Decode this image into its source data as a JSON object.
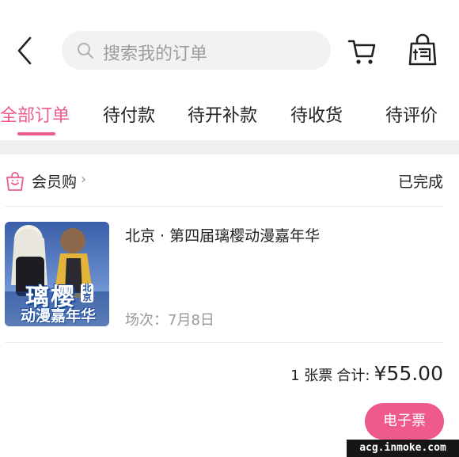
{
  "header": {
    "search_placeholder": "搜索我的订单",
    "icons": {
      "back": "chevron-left-icon",
      "search": "search-icon",
      "cart": "cart-icon",
      "bag": "shopping-bag-icon"
    }
  },
  "tabs": [
    {
      "label": "全部订单",
      "active": true
    },
    {
      "label": "待付款",
      "active": false
    },
    {
      "label": "待开补款",
      "active": false
    },
    {
      "label": "待收货",
      "active": false
    },
    {
      "label": "待评价",
      "active": false
    }
  ],
  "order": {
    "shop_name": "会员购",
    "status": "已完成",
    "event_title": "北京 · 第四届璃樱动漫嘉年华",
    "session": "场次：7月8日",
    "poster": {
      "main_text": "璃樱",
      "badge_text": "北京",
      "sub_text": "动漫嘉年华"
    },
    "quantity": "1 张票",
    "total_label": "合计:",
    "total_price": "¥55.00",
    "eticket_label": "电子票"
  },
  "watermark": "acg.inmoke.com",
  "colors": {
    "accent": "#ee5a8a",
    "gap": "#efefef",
    "muted": "#999999"
  }
}
